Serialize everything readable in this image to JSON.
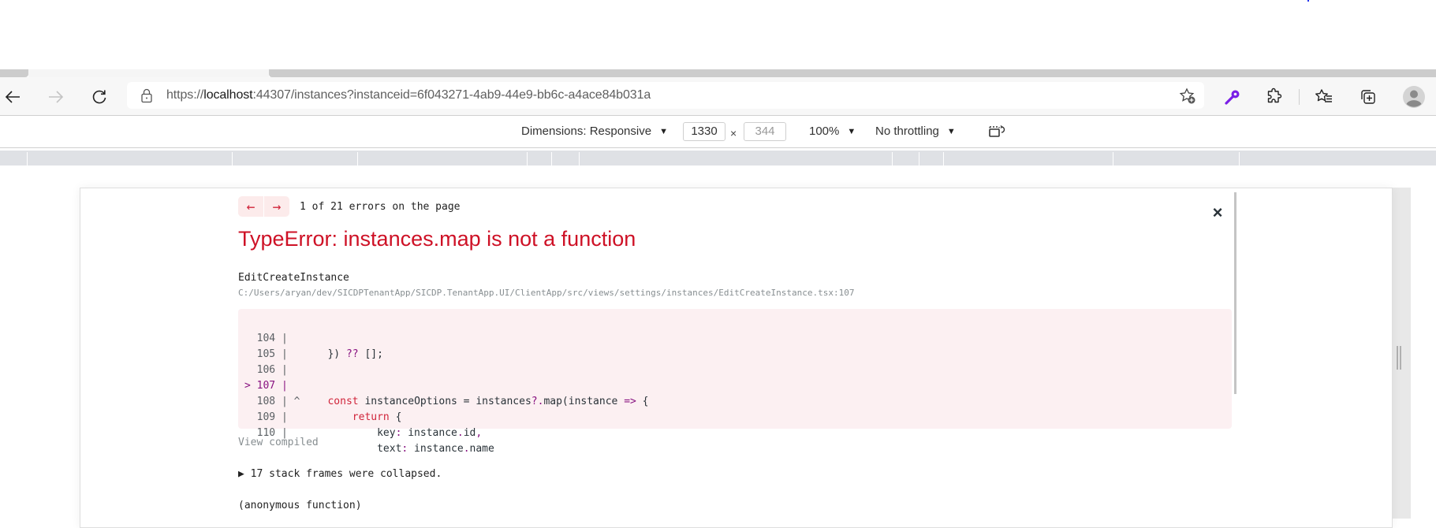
{
  "browser": {
    "url_prefix": "https://",
    "url_host": "localhost",
    "url_rest": ":44307/instances?instanceid=6f043271-4ab9-44e9-bb6c-a4ace84b031a",
    "icons": {
      "back": "arrow-left-icon",
      "forward": "arrow-right-icon",
      "reload": "reload-icon",
      "lock": "lock-icon",
      "add_favorite": "star-plus-icon",
      "extension_key": "key-icon",
      "extensions": "puzzle-icon",
      "favorites": "favorites-list-icon",
      "collections": "collections-icon",
      "profile": "profile-icon"
    },
    "accent_color": "#7a1fe6"
  },
  "devtools_bar": {
    "dimensions_label": "Dimensions: Responsive",
    "width_value": "1330",
    "times": "×",
    "height_value": "344",
    "zoom_label": "100%",
    "throttling_label": "No throttling",
    "rotate_icon": "rotate-icon"
  },
  "error_overlay": {
    "prev_arrow": "←",
    "next_arrow": "→",
    "error_count": "1 of 21 errors on the page",
    "close_symbol": "×",
    "title": "TypeError: instances.map is not a function",
    "component": "EditCreateInstance",
    "file_path": "C:/Users/aryan/dev/SICDPTenantApp/SICDP.TenantApp.UI/ClientApp/src/views/settings/instances/EditCreateInstance.tsx:107",
    "code_lines": [
      {
        "gutter": "  104 | ",
        "code": "   }) ?? [];"
      },
      {
        "gutter": "  105 | ",
        "code": ""
      },
      {
        "gutter": "  106 | ",
        "code": ""
      },
      {
        "gutter": "> 107 | ",
        "code": "   const instanceOptions = instances?.map(instance => {"
      },
      {
        "gutter": "  108 | ^",
        "code": "       return {"
      },
      {
        "gutter": "  109 | ",
        "code": "           key: instance.id,"
      },
      {
        "gutter": "  110 | ",
        "code": "           text: instance.name"
      }
    ],
    "view_compiled": "View compiled",
    "collapsed_frames": "▶ 17 stack frames were collapsed.",
    "anonymous_function": "(anonymous function)",
    "error_color": "#ce1126"
  }
}
